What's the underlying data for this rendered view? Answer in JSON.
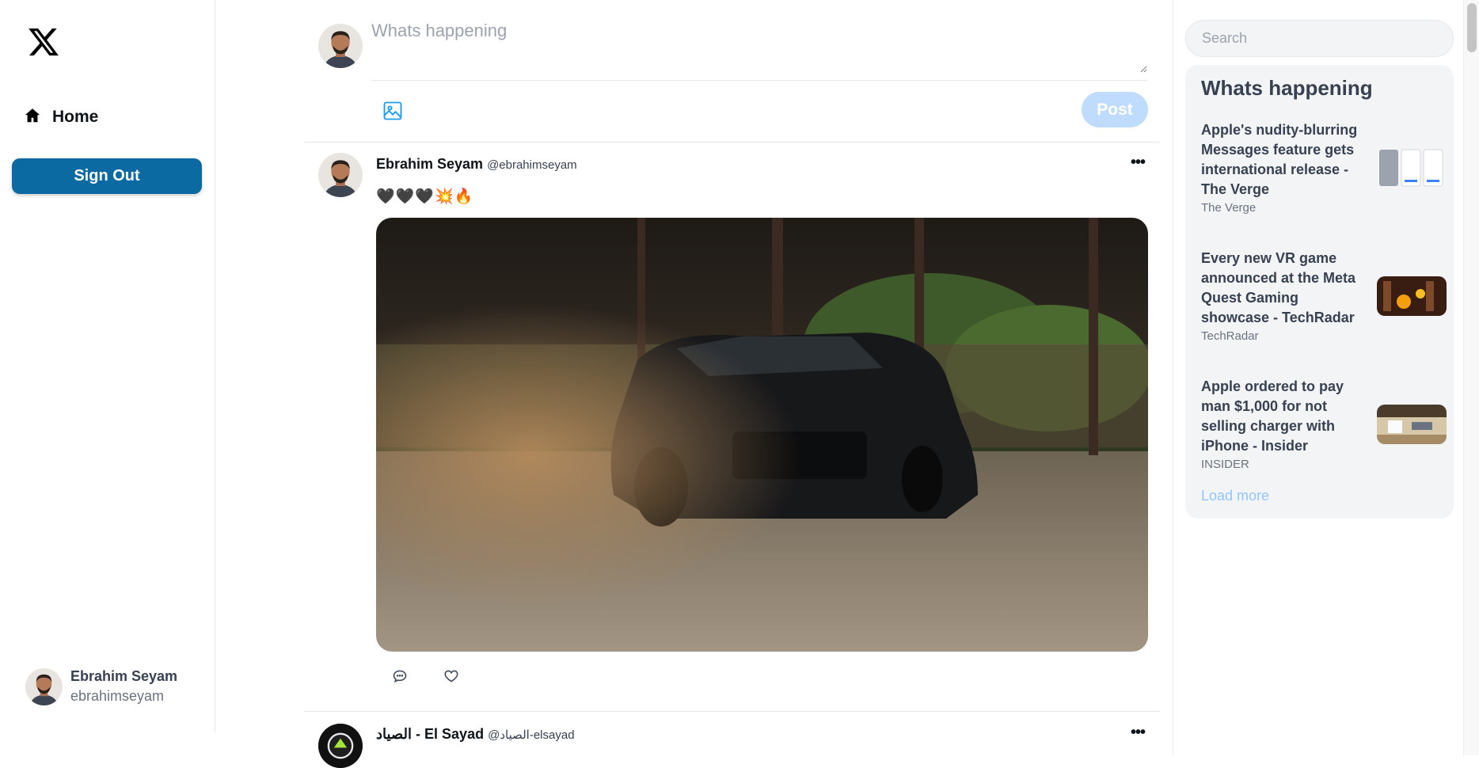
{
  "sidebar": {
    "logo_icon": "x-logo-icon",
    "nav": [
      {
        "label": "Home",
        "icon": "home-icon"
      }
    ],
    "signout_label": "Sign Out",
    "profile": {
      "name": "Ebrahim Seyam",
      "handle": "ebrahimseyam"
    }
  },
  "compose": {
    "placeholder": "Whats happening",
    "post_label": "Post",
    "image_icon": "image-icon"
  },
  "feed": {
    "tweets": [
      {
        "name": "Ebrahim Seyam",
        "handle": "@ebrahimseyam",
        "text": "🖤🖤🖤💥🔥",
        "has_image": true
      },
      {
        "name": "الصياد - El Sayad",
        "handle": "@الصياد-elsayad",
        "text": ""
      }
    ]
  },
  "right": {
    "search_placeholder": "Search",
    "trends_title": "Whats happening",
    "trends": [
      {
        "title": "Apple's nudity-blurring Messages feature gets international release - The Verge",
        "source": "The Verge"
      },
      {
        "title": "Every new VR game announced at the Meta Quest Gaming showcase - TechRadar",
        "source": "TechRadar"
      },
      {
        "title": "Apple ordered to pay man $1,000 for not selling charger with iPhone - Insider",
        "source": "INSIDER"
      }
    ],
    "load_more": "Load more"
  },
  "colors": {
    "brand_blue": "#0b6aa2",
    "post_button_disabled": "#bfdbfe",
    "link": "#93c5fd",
    "panel": "#f3f4f6"
  }
}
